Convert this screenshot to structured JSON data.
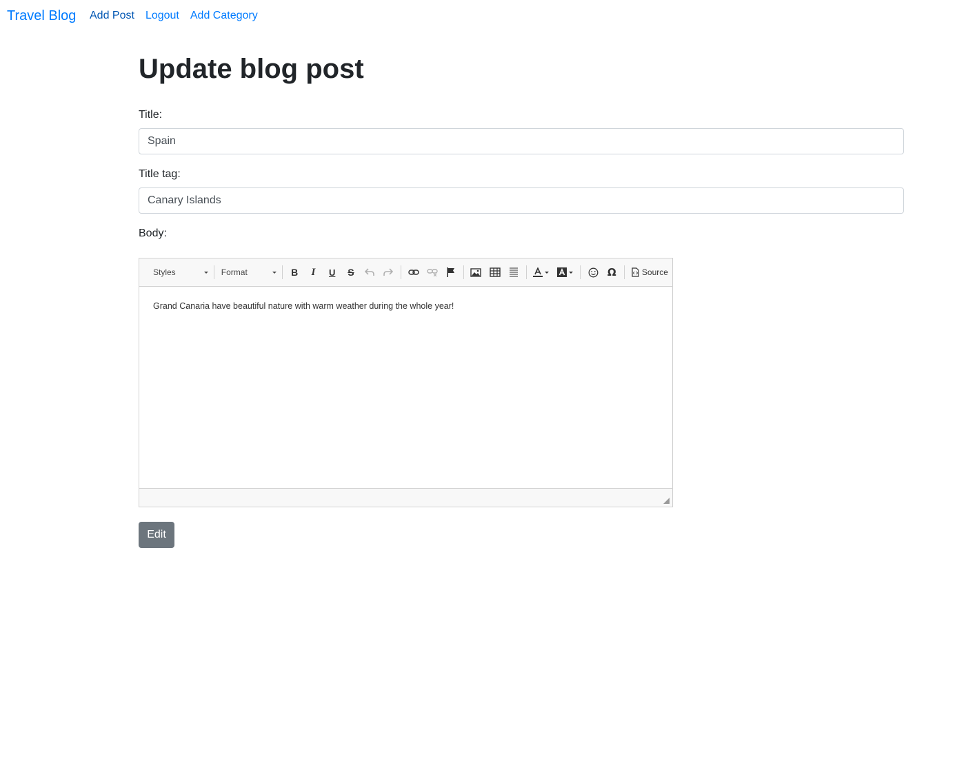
{
  "navbar": {
    "brand": "Travel Blog",
    "links": [
      {
        "label": "Add Post"
      },
      {
        "label": "Logout"
      },
      {
        "label": "Add Category"
      }
    ]
  },
  "page": {
    "title": "Update blog post"
  },
  "form": {
    "title_label": "Title:",
    "title_value": "Spain",
    "title_tag_label": "Title tag:",
    "title_tag_value": "Canary Islands",
    "body_label": "Body:",
    "submit_label": "Edit"
  },
  "editor": {
    "styles_combo": "Styles",
    "format_combo": "Format",
    "source_label": "Source",
    "content": "Grand Canaria have beautiful nature with warm weather during the whole year!"
  },
  "colors": {
    "link": "#007bff",
    "link_active": "#0056b3",
    "button": "#6c757d"
  }
}
